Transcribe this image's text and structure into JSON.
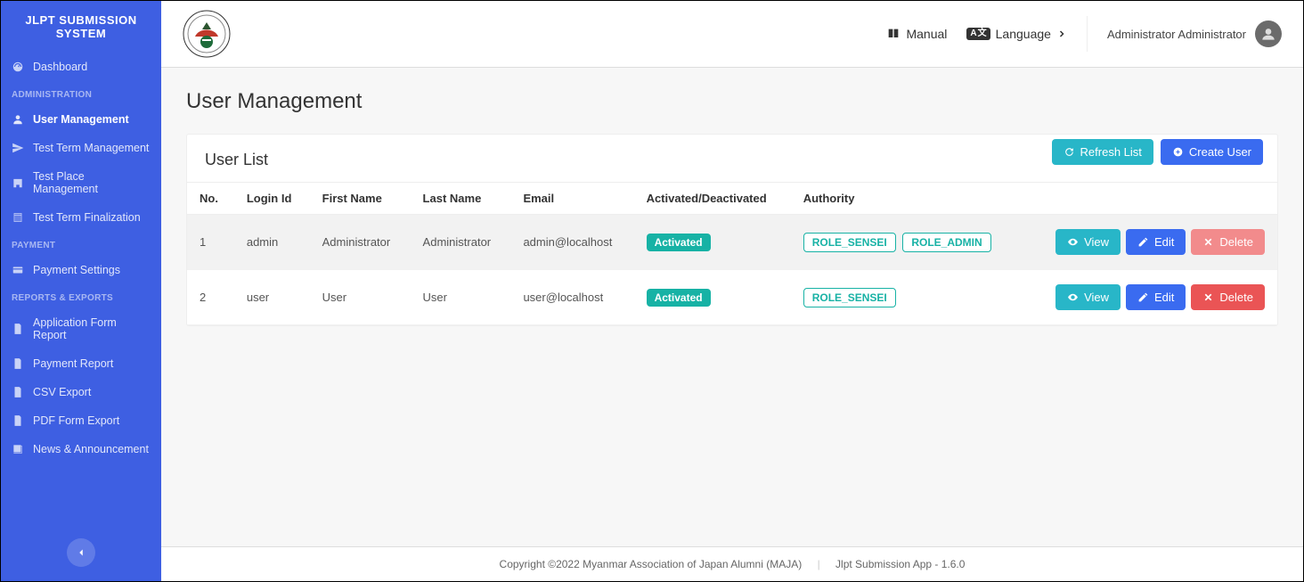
{
  "brand": "JLPT SUBMISSION SYSTEM",
  "sidebar": {
    "dashboard": "Dashboard",
    "sec_admin": "ADMINISTRATION",
    "user_mgmt": "User Management",
    "test_term_mgmt": "Test Term Management",
    "test_place_mgmt": "Test Place Management",
    "test_term_final": "Test Term Finalization",
    "sec_payment": "PAYMENT",
    "payment_settings": "Payment Settings",
    "sec_reports": "REPORTS & EXPORTS",
    "app_form_report": "Application Form Report",
    "payment_report": "Payment Report",
    "csv_export": "CSV Export",
    "pdf_export": "PDF Form Export",
    "news": "News & Announcement"
  },
  "topbar": {
    "manual": "Manual",
    "language": "Language",
    "username": "Administrator Administrator"
  },
  "page": {
    "title": "User Management",
    "list_title": "User List",
    "refresh": "Refresh List",
    "create": "Create User"
  },
  "table": {
    "headers": {
      "no": "No.",
      "login": "Login Id",
      "first": "First Name",
      "last": "Last Name",
      "email": "Email",
      "status": "Activated/Deactivated",
      "authority": "Authority"
    },
    "status_activated": "Activated",
    "actions": {
      "view": "View",
      "edit": "Edit",
      "delete": "Delete"
    },
    "rows": [
      {
        "no": "1",
        "login": "admin",
        "first": "Administrator",
        "last": "Administrator",
        "email": "admin@localhost",
        "roles": [
          "ROLE_SENSEI",
          "ROLE_ADMIN"
        ],
        "delete_disabled": true
      },
      {
        "no": "2",
        "login": "user",
        "first": "User",
        "last": "User",
        "email": "user@localhost",
        "roles": [
          "ROLE_SENSEI"
        ],
        "delete_disabled": false
      }
    ]
  },
  "footer": {
    "left": "Copyright ©2022 Myanmar Association of Japan Alumni (MAJA)",
    "right": "Jlpt Submission App - 1.6.0"
  }
}
